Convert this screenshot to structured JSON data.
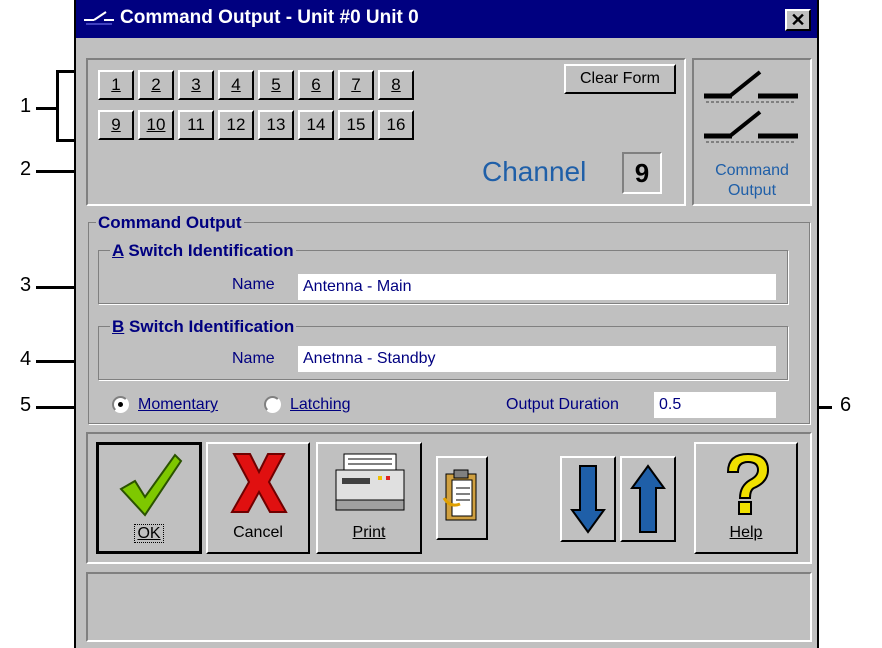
{
  "window": {
    "title": "Command Output - Unit #0 Unit 0",
    "close_label": "✕"
  },
  "callouts": {
    "c1": "1",
    "c2": "2",
    "c3": "3",
    "c4": "4",
    "c5": "5",
    "c6": "6"
  },
  "channels": {
    "row1": [
      "1",
      "2",
      "3",
      "4",
      "5",
      "6",
      "7",
      "8"
    ],
    "row2": [
      "9",
      "10",
      "11",
      "12",
      "13",
      "14",
      "15",
      "16"
    ],
    "clear_form_label": "Clear Form",
    "channel_label": "Channel",
    "channel_value": "9"
  },
  "side_icon": {
    "label_line1": "Command",
    "label_line2": "Output"
  },
  "command_output": {
    "group_label": "Command Output",
    "a_switch": {
      "prefix": "A",
      "title": " Switch Identification",
      "name_label": "Name",
      "name_value": "Antenna - Main"
    },
    "b_switch": {
      "prefix": "B",
      "title": " Switch Identification",
      "name_label": "Name",
      "name_value": "Anetnna - Standby"
    },
    "mode": {
      "momentary_label": "Momentary",
      "latching_label": "Latching",
      "selected": "Momentary"
    },
    "duration": {
      "label": "Output Duration",
      "value": "0.5"
    }
  },
  "toolbar": {
    "ok_label": "OK",
    "cancel_label": "Cancel",
    "print_label": "Print",
    "help_label": "Help"
  },
  "colors": {
    "titlebar": "#000080",
    "face": "#c0c0c0",
    "accent_text": "#1f5fa8"
  }
}
